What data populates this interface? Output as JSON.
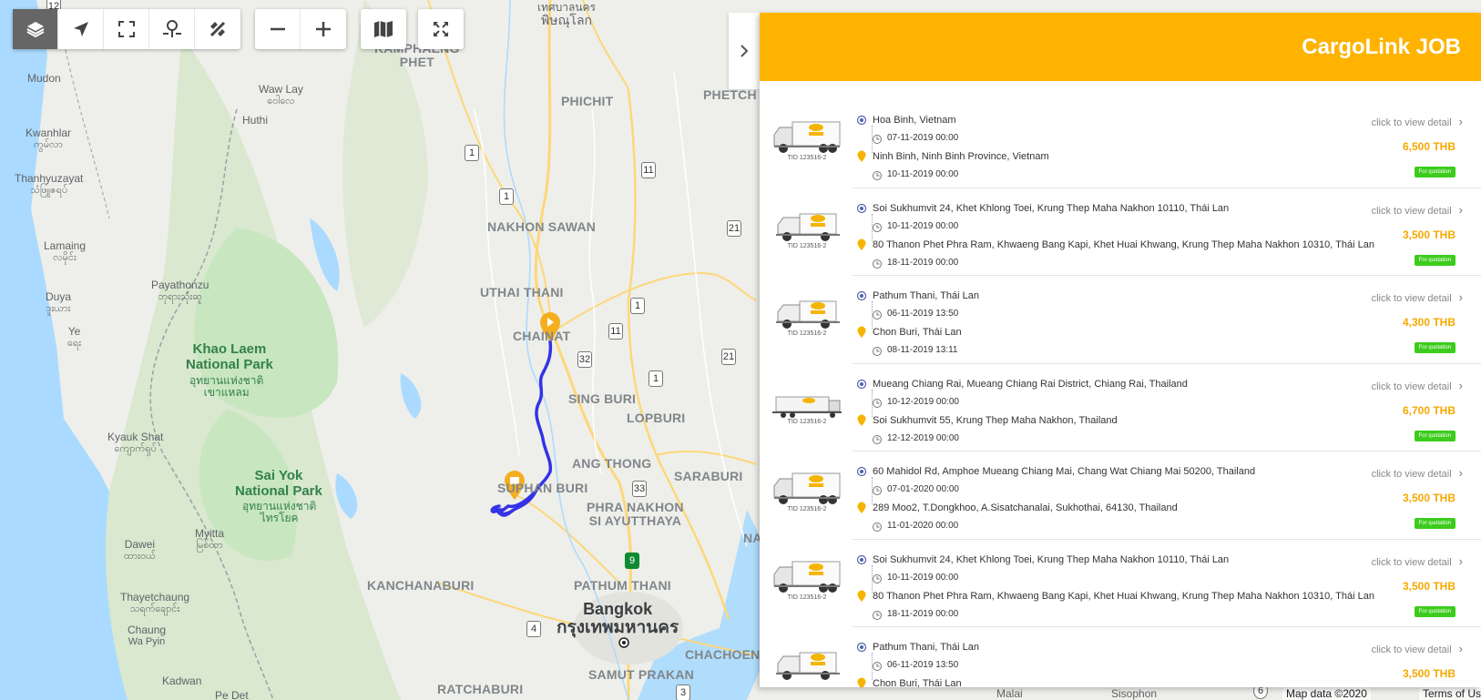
{
  "panel": {
    "title": "CargoLink JOB",
    "collapse_icon": "chevron-right-icon",
    "jobs": [
      {
        "tid": "TID 123516-2",
        "truck": "box-truck",
        "from": "Hoa Binh, Vietnam",
        "from_time": "07-11-2019 00:00",
        "to": "Ninh Binh, Ninh Binh Province, Vietnam",
        "to_time": "10-11-2019 00:00",
        "detail": "click to view detail",
        "price": "6,500 THB",
        "badge": "For quotation"
      },
      {
        "tid": "TID 123516-2",
        "truck": "pickup-truck",
        "from": "Soi Sukhumvit 24, Khet Khlong Toei, Krung Thep Maha Nakhon 10110, Thái Lan",
        "from_time": "10-11-2019 00:00",
        "to": "80 Thanon Phet Phra Ram, Khwaeng Bang Kapi, Khet Huai Khwang, Krung Thep Maha Nakhon 10310, Thái Lan",
        "to_time": "18-11-2019 00:00",
        "detail": "click to view detail",
        "price": "3,500 THB",
        "badge": "For quotation"
      },
      {
        "tid": "TID 123516-2",
        "truck": "pickup-truck",
        "from": "Pathum Thani, Thái Lan",
        "from_time": "06-11-2019 13:50",
        "to": "Chon Buri, Thái Lan",
        "to_time": "08-11-2019 13:11",
        "detail": "click to view detail",
        "price": "4,300 THB",
        "badge": "For quotation"
      },
      {
        "tid": "TID 123516-2",
        "truck": "trailer-truck",
        "from": "Mueang Chiang Rai, Mueang Chiang Rai District, Chiang Rai, Thailand",
        "from_time": "10-12-2019 00:00",
        "to": "Soi Sukhumvit 55, Krung Thep Maha Nakhon, Thailand",
        "to_time": "12-12-2019 00:00",
        "detail": "click to view detail",
        "price": "6,700 THB",
        "badge": "For quotation"
      },
      {
        "tid": "TID 123516-2",
        "truck": "box-truck",
        "from": "60 Mahidol Rd, Amphoe Mueang Chiang Mai, Chang Wat Chiang Mai 50200, Thailand",
        "from_time": "07-01-2020 00:00",
        "to": "289 Moo2, T.Dongkhoo, A.Sisatchanalai, Sukhothai, 64130, Thailand",
        "to_time": "11-01-2020 00:00",
        "detail": "click to view detail",
        "price": "3,500 THB",
        "badge": "For quotation"
      },
      {
        "tid": "TID 123516-2",
        "truck": "box-truck",
        "from": "Soi Sukhumvit 24, Khet Khlong Toei, Krung Thep Maha Nakhon 10110, Thái Lan",
        "from_time": "10-11-2019 00:00",
        "to": "80 Thanon Phet Phra Ram, Khwaeng Bang Kapi, Khet Huai Khwang, Krung Thep Maha Nakhon 10310, Thái Lan",
        "to_time": "18-11-2019 00:00",
        "detail": "click to view detail",
        "price": "3,500 THB",
        "badge": "For quotation"
      },
      {
        "tid": "",
        "truck": "pickup-truck",
        "from": "Pathum Thani, Thái Lan",
        "from_time": "06-11-2019 13:50",
        "to": "Chon Buri, Thái Lan",
        "to_time": "",
        "detail": "click to view detail",
        "price": "3,500 THB",
        "badge": ""
      }
    ]
  },
  "toolbar": {
    "groups": [
      [
        "layers-icon",
        "navigate-arrow-icon",
        "frame-icon",
        "location-pin-icon",
        "measure-tools-icon"
      ],
      [
        "zoom-out-icon",
        "zoom-in-icon"
      ],
      [
        "map-icon"
      ],
      [
        "fullscreen-icon"
      ]
    ],
    "active_color": "#666666"
  },
  "map": {
    "labels": [
      {
        "t": "เทศบาลนคร",
        "s": "พิษณุโลก",
        "k": "town"
      },
      {
        "t": "KAMPHAENG",
        "s": "PHET",
        "k": "prov"
      },
      {
        "t": "PHICHIT",
        "k": "prov"
      },
      {
        "t": "PHETCH",
        "k": "prov"
      },
      {
        "t": "NAKHON SAWAN",
        "k": "prov"
      },
      {
        "t": "UTHAI THANI",
        "k": "prov"
      },
      {
        "t": "CHAINAT",
        "k": "prov"
      },
      {
        "t": "SING BURI",
        "k": "prov"
      },
      {
        "t": "LOPBURI",
        "k": "prov"
      },
      {
        "t": "ANG THONG",
        "k": "prov"
      },
      {
        "t": "SARABURI",
        "k": "prov"
      },
      {
        "t": "SUPHAN BURI",
        "k": "prov"
      },
      {
        "t": "PHRA NAKHON",
        "s": "SI AYUTTHAYA",
        "k": "prov"
      },
      {
        "t": "KANCHANABURI",
        "k": "prov"
      },
      {
        "t": "PATHUM THANI",
        "k": "prov"
      },
      {
        "t": "NA",
        "k": "prov"
      },
      {
        "t": "CHACHOEN",
        "k": "prov"
      },
      {
        "t": "SAMUT PRAKAN",
        "k": "prov"
      },
      {
        "t": "RATCHABURI",
        "k": "prov"
      },
      {
        "t": "Bangkok",
        "s": "กรุงเทพมหานคร",
        "k": "big"
      },
      {
        "t": "Mudon",
        "k": "town"
      },
      {
        "t": "Waw Lay",
        "s": "ဝေါလေ",
        "k": "town"
      },
      {
        "t": "Huthi",
        "k": "town"
      },
      {
        "t": "Kwanhlar",
        "s": "ကွမ်လာ",
        "k": "town"
      },
      {
        "t": "Thanhyuzayat",
        "s": "သံဖြူဇရပ်",
        "k": "town"
      },
      {
        "t": "Lamaing",
        "s": "လမိုင်း",
        "k": "town"
      },
      {
        "t": "Payathonzu",
        "s": "ဘုရားသုံးဆူ",
        "k": "town"
      },
      {
        "t": "Duya",
        "s": "ဒူးယား",
        "k": "town"
      },
      {
        "t": "Ye",
        "s": "ရေး",
        "k": "town"
      },
      {
        "t": "Kyauk Shat",
        "s": "ကျောက်ရှပ်",
        "k": "town"
      },
      {
        "t": "Dawei",
        "s": "ထားဝယ်",
        "k": "town"
      },
      {
        "t": "Myitta",
        "s": "မြစ်တာ",
        "k": "town"
      },
      {
        "t": "Thayetchaung",
        "s": "သရက်ချောင်း",
        "k": "town"
      },
      {
        "t": "Chaung",
        "s": "Wa Pyin",
        "k": "town"
      },
      {
        "t": "Kadwan",
        "k": "town"
      },
      {
        "t": "Pe Det",
        "k": "town"
      },
      {
        "t": "Malai",
        "k": "town"
      },
      {
        "t": "Sisophon",
        "k": "town"
      },
      {
        "t": "Khao Laem",
        "s": "National Park",
        "k": "park"
      },
      {
        "t": "อุทยานแห่งชาติ",
        "s": "เขาแหลม",
        "k": "park"
      },
      {
        "t": "Sai Yok",
        "s": "National Park",
        "k": "park"
      },
      {
        "t": "อุทยานแห่งชาติ",
        "s": "ไทรโยค",
        "k": "park"
      }
    ],
    "shields": [
      "12",
      "1",
      "11",
      "1",
      "21",
      "1",
      "11",
      "32",
      "1",
      "21",
      "33",
      "9",
      "4",
      "3",
      "6"
    ],
    "route_color": "#3333e6",
    "water_color": "#aadaff",
    "park_color": "#c8e6c0",
    "road_color": "#fdd77a",
    "attribution": "Map data ©2020",
    "terms": "Terms of Us"
  }
}
